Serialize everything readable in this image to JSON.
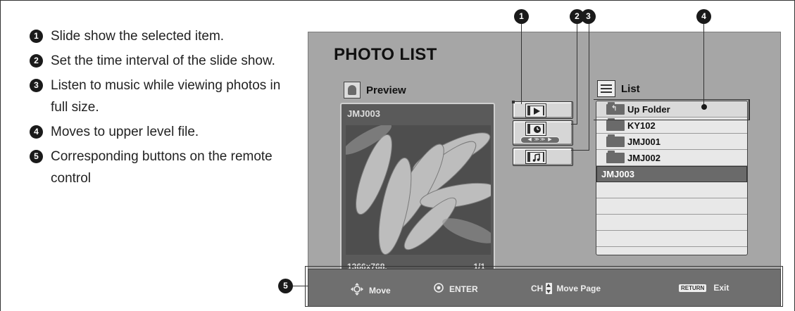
{
  "instructions": [
    {
      "num": "1",
      "text": "Slide show the selected item."
    },
    {
      "num": "2",
      "text": "Set the time interval of the slide show."
    },
    {
      "num": "3",
      "text": "Listen to music while viewing photos in full size."
    },
    {
      "num": "4",
      "text": "Moves to upper level file."
    },
    {
      "num": "5",
      "text": "Corresponding buttons on the remote control"
    }
  ],
  "markers": {
    "m1": "1",
    "m2": "2",
    "m3": "3",
    "m4": "4",
    "m5": "5"
  },
  "screen": {
    "title": "PHOTO LIST",
    "preview": {
      "label": "Preview",
      "file_name": "JMJ003",
      "resolution": "1366x768,",
      "page": "1/1"
    },
    "buttons": [
      {
        "name": "slide-show-icon"
      },
      {
        "name": "time-interval-icon"
      },
      {
        "name": "music-icon"
      }
    ],
    "list": {
      "label": "List",
      "items": [
        {
          "label": "Up Folder",
          "type": "up"
        },
        {
          "label": "KY102",
          "type": "folder"
        },
        {
          "label": "JMJ001",
          "type": "folder"
        },
        {
          "label": "JMJ002",
          "type": "folder"
        },
        {
          "label": "JMJ003",
          "type": "selected"
        },
        {
          "label": "",
          "type": "empty"
        },
        {
          "label": "",
          "type": "empty"
        },
        {
          "label": "",
          "type": "empty"
        },
        {
          "label": "",
          "type": "empty"
        }
      ]
    }
  },
  "bottom_bar": {
    "move": "Move",
    "enter": "ENTER",
    "ch": "CH",
    "move_page": "Move Page",
    "return_badge": "RETURN",
    "exit": "Exit"
  },
  "colors": {
    "screen_bg": "#a6a6a6",
    "bar_bg": "#6f6f6f",
    "selected_row": "#6a6a6a",
    "list_bg": "#e8e8e8"
  }
}
